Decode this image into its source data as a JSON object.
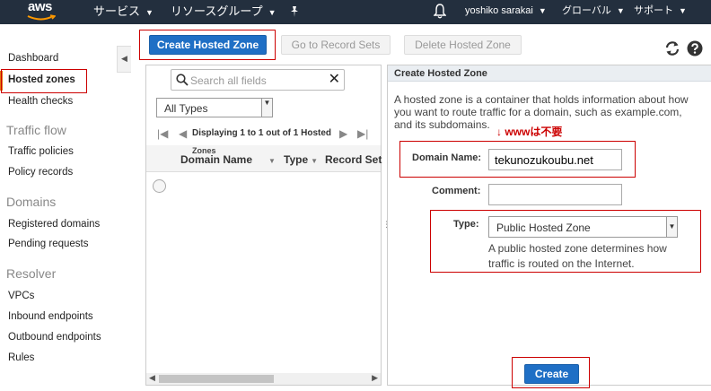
{
  "topnav": {
    "logo": "aws",
    "services": "サービス",
    "resource_groups": "リソースグループ",
    "user": "yoshiko sarakai",
    "region": "グローバル",
    "support": "サポート"
  },
  "sidebar": {
    "dashboard": "Dashboard",
    "hosted_zones": "Hosted zones",
    "health_checks": "Health checks",
    "traffic_flow": "Traffic flow",
    "traffic_policies": "Traffic policies",
    "policy_records": "Policy records",
    "domains": "Domains",
    "registered_domains": "Registered domains",
    "pending_requests": "Pending requests",
    "resolver": "Resolver",
    "vpcs": "VPCs",
    "inbound_endpoints": "Inbound endpoints",
    "outbound_endpoints": "Outbound endpoints",
    "rules": "Rules"
  },
  "toolbar": {
    "create_hosted_zone": "Create Hosted Zone",
    "go_to_record_sets": "Go to Record Sets",
    "delete_hosted_zone": "Delete Hosted Zone"
  },
  "list": {
    "search_placeholder": "Search all fields",
    "filter_value": "All Types",
    "pager_text": "Displaying 1 to 1 out of 1 Hosted",
    "col_super": "Zones",
    "columns": [
      "Domain Name",
      "Type",
      "Record Set"
    ]
  },
  "form": {
    "title": "Create Hosted Zone",
    "description": "A hosted zone is a container that holds information about how you want to route traffic for a domain, such as example.com, and its subdomains.",
    "note": "↓ wwwは不要",
    "domain_label": "Domain Name:",
    "domain_value": "tekunozukoubu.net",
    "comment_label": "Comment:",
    "comment_value": "",
    "type_label": "Type:",
    "type_value": "Public Hosted Zone",
    "type_help": "A public hosted zone determines how traffic is routed on the Internet.",
    "create_button": "Create"
  },
  "colors": {
    "nav_bg": "#232f3e",
    "primary": "#1f6fc5",
    "highlight_box": "#cc0000",
    "active_marker": "#e47911"
  }
}
